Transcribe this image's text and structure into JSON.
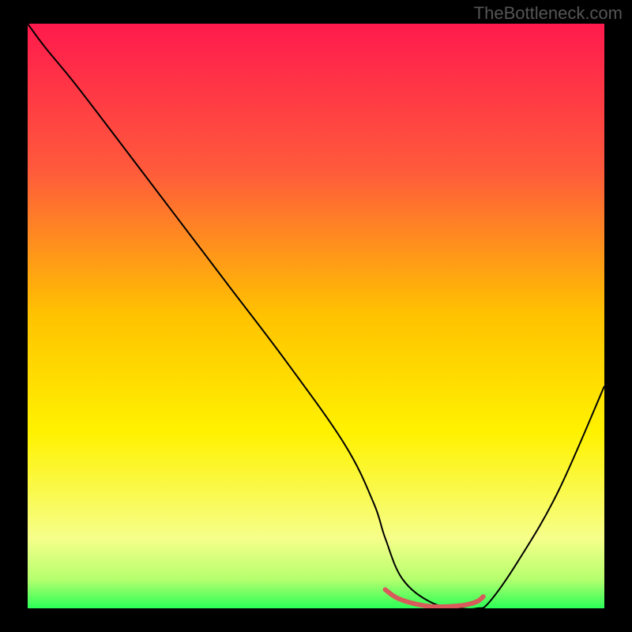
{
  "watermark": "TheBottleneck.com",
  "chart_data": {
    "type": "line",
    "title": "",
    "xlabel": "",
    "ylabel": "",
    "xlim": [
      0,
      100
    ],
    "ylim": [
      0,
      100
    ],
    "background_gradient": {
      "stops": [
        {
          "offset": 0,
          "color": "#ff1a4d"
        },
        {
          "offset": 25,
          "color": "#ff5a3c"
        },
        {
          "offset": 50,
          "color": "#ffc300"
        },
        {
          "offset": 70,
          "color": "#fff200"
        },
        {
          "offset": 88,
          "color": "#f6ff8a"
        },
        {
          "offset": 95,
          "color": "#b6ff6e"
        },
        {
          "offset": 100,
          "color": "#2bff57"
        }
      ]
    },
    "series": [
      {
        "name": "bottleneck-curve",
        "color": "#000000",
        "width": 2,
        "x": [
          0,
          3,
          8,
          15,
          25,
          35,
          45,
          55,
          60,
          62,
          65,
          70,
          75,
          78,
          80,
          85,
          92,
          100
        ],
        "y": [
          100,
          96,
          90,
          81,
          68,
          55,
          42,
          28,
          18,
          12,
          5,
          1,
          0,
          0,
          1,
          8,
          20,
          38
        ]
      },
      {
        "name": "sweet-spot-marker",
        "color": "#d85a5a",
        "width": 6,
        "x": [
          62,
          64,
          67,
          70,
          73,
          76,
          78,
          79
        ],
        "y": [
          3.2,
          1.8,
          0.8,
          0.3,
          0.3,
          0.6,
          1.2,
          2.0
        ]
      }
    ]
  }
}
